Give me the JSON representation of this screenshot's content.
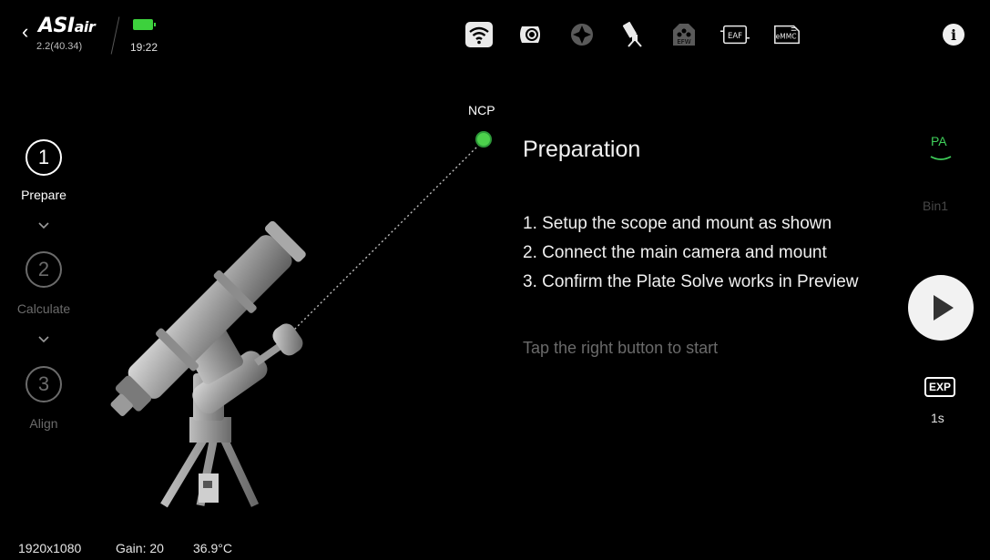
{
  "app": {
    "logo_main": "ASI",
    "logo_tail": "air",
    "version": "2.2(40.34)",
    "time": "19:22"
  },
  "top_icons": [
    "wifi-icon",
    "main-camera-icon",
    "guide-icon",
    "mount-icon",
    "filter-wheel-icon",
    "focuser-icon",
    "storage-icon",
    "info-icon"
  ],
  "icon_labels": {
    "efw": "EFW",
    "eaf": "EAF",
    "emmc": "eMMC",
    "info": "i"
  },
  "steps": [
    {
      "number": "1",
      "label": "Prepare",
      "active": true
    },
    {
      "number": "2",
      "label": "Calculate",
      "active": false
    },
    {
      "number": "3",
      "label": "Align",
      "active": false
    }
  ],
  "main": {
    "ncp_label": "NCP",
    "title": "Preparation",
    "items": [
      "1. Setup the scope and mount as shown",
      "2. Connect the main camera and mount",
      "3. Confirm the Plate Solve works in Preview"
    ],
    "hint": "Tap the right button to start"
  },
  "right": {
    "pa_label": "PA",
    "bin_label": "Bin1",
    "exp_label": "EXP",
    "exp_value": "1s"
  },
  "status": {
    "resolution": "1920x1080",
    "gain": "Gain: 20",
    "temperature": "36.9°C"
  },
  "colors": {
    "accent_green": "#3fcf5a",
    "dim_text": "#6b6b6b",
    "background": "#000000"
  }
}
